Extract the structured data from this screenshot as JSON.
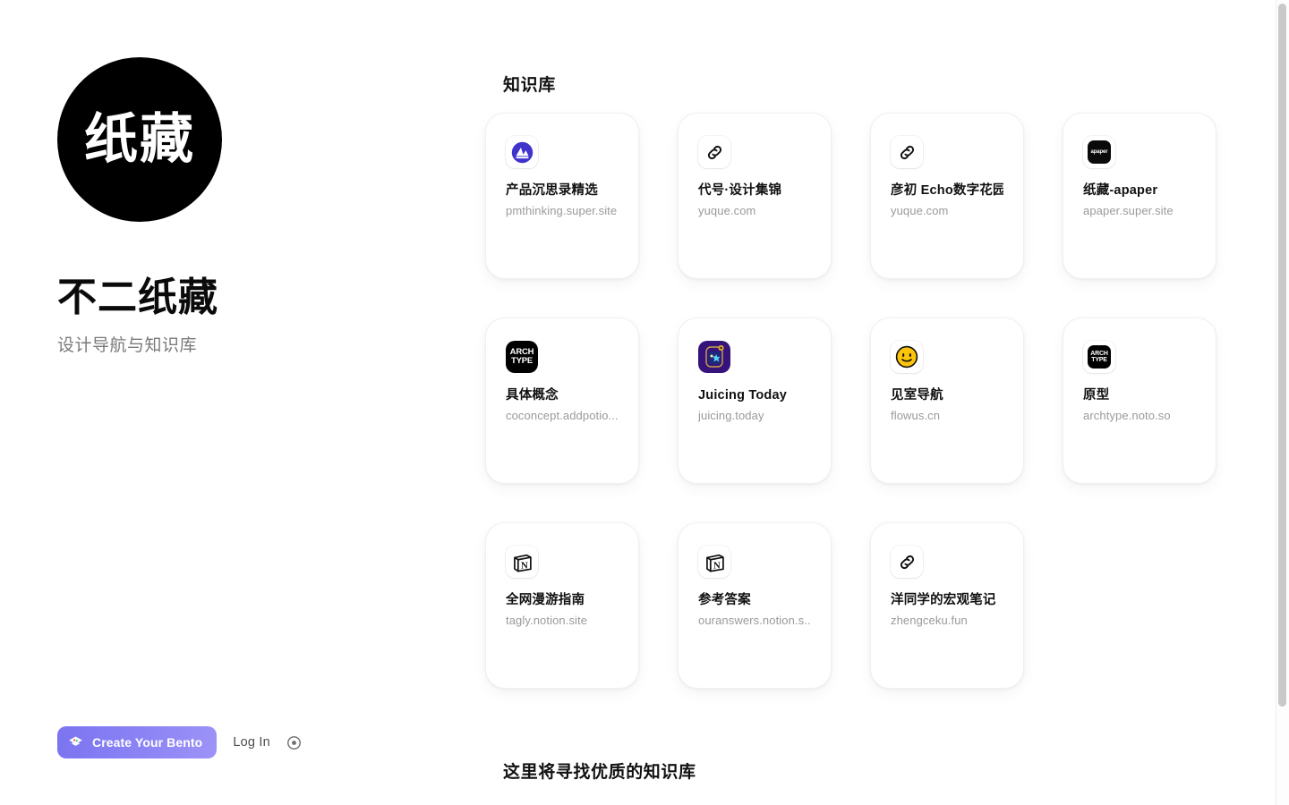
{
  "profile": {
    "avatar_text": "纸藏",
    "avatar_icon": "avatar-circle-black",
    "title": "不二纸藏",
    "subtitle": "设计导航与知识库"
  },
  "action_bar": {
    "create_label": "Create Your Bento",
    "create_icon": "bento-box-icon",
    "login_label": "Log In",
    "record_icon": "record-circle-icon",
    "accent_color": "#8a82f5"
  },
  "main": {
    "section_title": "知识库",
    "footer_title": "这里将寻找优质的知识库",
    "cards": [
      {
        "title": "产品沉思录精选",
        "url": "pmthinking.super.site",
        "icon": "pmthinking-logo-icon"
      },
      {
        "title": "代号·设计集锦",
        "url": "yuque.com",
        "icon": "link-icon"
      },
      {
        "title": "彦初 Echo数字花园",
        "url": "yuque.com",
        "icon": "link-icon"
      },
      {
        "title": "纸藏-apaper",
        "url": "apaper.super.site",
        "icon": "apaper-logo-icon",
        "icon_label": "apaper"
      },
      {
        "title": "具体概念",
        "url": "coconcept.addpotio...",
        "icon": "archtype-logo-icon",
        "icon_label_top": "ARCH",
        "icon_label_bottom": "TYPE"
      },
      {
        "title": "Juicing Today",
        "url": "juicing.today",
        "icon": "juicing-potion-icon"
      },
      {
        "title": "见室导航",
        "url": "flowus.cn",
        "icon": "smiley-face-icon"
      },
      {
        "title": "原型",
        "url": "archtype.noto.so",
        "icon": "archtype-logo-icon",
        "icon_label_top": "ARCH",
        "icon_label_bottom": "TYPE"
      },
      {
        "title": "全网漫游指南",
        "url": "tagly.notion.site",
        "icon": "notion-logo-icon"
      },
      {
        "title": "参考答案",
        "url": "ouranswers.notion.s...",
        "icon": "notion-logo-icon"
      },
      {
        "title": "洋同学的宏观笔记",
        "url": "zhengceku.fun",
        "icon": "link-icon"
      }
    ]
  },
  "scrollbar": {
    "name": "vertical-scrollbar"
  }
}
